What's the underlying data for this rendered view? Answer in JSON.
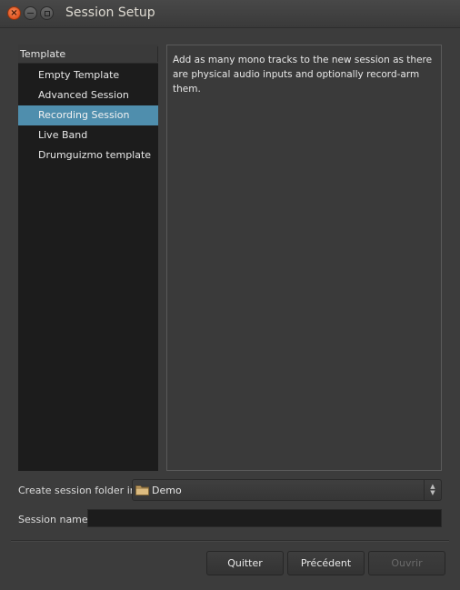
{
  "window": {
    "title": "Session Setup"
  },
  "templates": {
    "header": "Template",
    "items": [
      {
        "label": "Empty Template"
      },
      {
        "label": "Advanced Session"
      },
      {
        "label": "Recording Session"
      },
      {
        "label": "Live Band"
      },
      {
        "label": "Drumguizmo template"
      }
    ],
    "selected": "Recording Session"
  },
  "description": {
    "text": "Add as many mono tracks to the new session as there are physical audio inputs and optionally record-arm them."
  },
  "folder": {
    "label": "Create session folder in:",
    "value": "Demo",
    "icon": "folder-icon"
  },
  "session_name": {
    "label": "Session name:",
    "value": ""
  },
  "buttons": {
    "quit": "Quitter",
    "previous": "Précédent",
    "open": "Ouvrir"
  },
  "colors": {
    "selection": "#4f8ead",
    "close_button": "#e0521f"
  }
}
